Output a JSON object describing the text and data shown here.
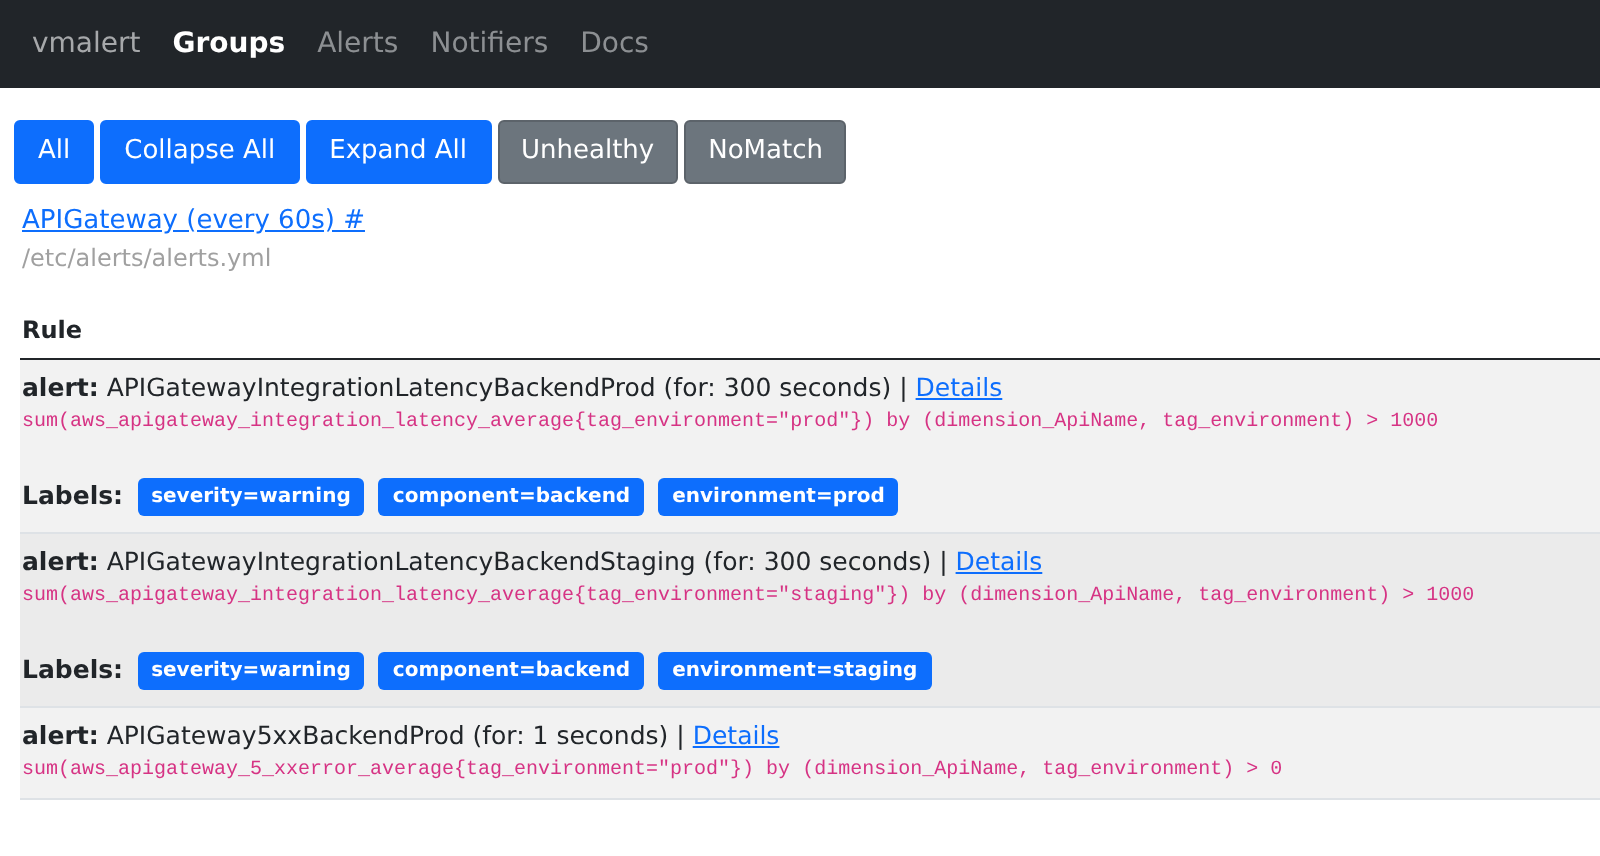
{
  "navbar": {
    "brand": "vmalert",
    "items": [
      {
        "label": "Groups",
        "selected": true
      },
      {
        "label": "Alerts",
        "selected": false
      },
      {
        "label": "Notifiers",
        "selected": false
      },
      {
        "label": "Docs",
        "selected": false
      }
    ]
  },
  "filters": [
    {
      "label": "All",
      "selected": true
    },
    {
      "label": "Collapse All",
      "selected": true
    },
    {
      "label": "Expand All",
      "selected": true
    },
    {
      "label": "Unhealthy",
      "selected": false
    },
    {
      "label": "NoMatch",
      "selected": false
    }
  ],
  "group": {
    "title": "APIGateway (every 60s) #",
    "file": "/etc/alerts/alerts.yml"
  },
  "table": {
    "column": "Rule",
    "rows": [
      {
        "prefix": "alert:",
        "name": "APIGatewayIntegrationLatencyBackendProd (for: 300 seconds) |",
        "link": "Details",
        "expr": "sum(aws_apigateway_integration_latency_average{tag_environment=\"prod\"}) by (dimension_ApiName, tag_environment) > 1000",
        "labels_title": "Labels:",
        "labels": [
          "severity=warning",
          "component=backend",
          "environment=prod"
        ]
      },
      {
        "prefix": "alert:",
        "name": "APIGatewayIntegrationLatencyBackendStaging (for: 300 seconds) |",
        "link": "Details",
        "expr": "sum(aws_apigateway_integration_latency_average{tag_environment=\"staging\"}) by (dimension_ApiName, tag_environment) > 1000",
        "labels_title": "Labels:",
        "labels": [
          "severity=warning",
          "component=backend",
          "environment=staging"
        ]
      },
      {
        "prefix": "alert:",
        "name": "APIGateway5xxBackendProd (for: 1 seconds) |",
        "link": "Details",
        "expr": "sum(aws_apigateway_5_xxerror_average{tag_environment=\"prod\"}) by (dimension_ApiName, tag_environment) > 0"
      }
    ]
  }
}
